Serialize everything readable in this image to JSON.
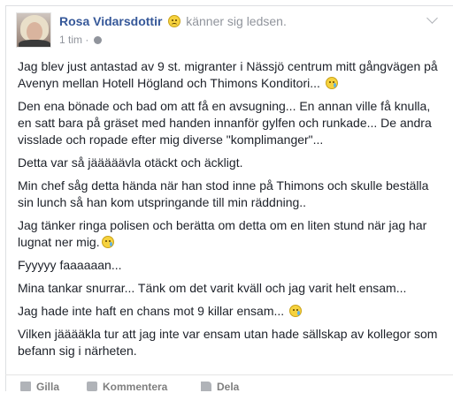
{
  "post": {
    "author": "Rosa Vidarsdottir",
    "feeling": "känner sig ledsen.",
    "time": "1 tim",
    "separator": "·",
    "paragraphs": [
      "Jag blev just antastad av 9 st. migranter i Nässjö centrum mitt gångvägen på Avenyn mellan Hotell Högland och Thimons Konditori...",
      "Den ena bönade och bad om att få en avsugning... En annan ville få knulla, en satt bara på gräset med handen innanför gylfen och runkade... De andra visslade och ropade efter mig diverse \"komplimanger\"...",
      "Detta var så jääääävla otäckt och äckligt.",
      "Min chef såg detta hända när han stod inne på Thimons och skulle beställa sin lunch så han kom utspringande till min räddning..",
      "Jag tänker ringa polisen och berätta om detta om en liten stund när jag har lugnat ner mig.",
      "Fyyyyy faaaaaan...",
      "Mina tankar snurrar... Tänk om det varit kväll och jag varit helt ensam...",
      "Jag hade inte haft en chans mot 9 killar ensam...",
      "Vilken jääääkla tur att jag inte var ensam utan hade sällskap av kollegor som befann sig i närheten."
    ]
  },
  "actions": {
    "like": "Gilla",
    "comment": "Kommentera",
    "share": "Dela"
  },
  "icons": {
    "feeling": "sad-face-icon",
    "privacy": "globe-icon",
    "menu": "chevron-down-icon",
    "emoji": "crying-face-emoji"
  }
}
